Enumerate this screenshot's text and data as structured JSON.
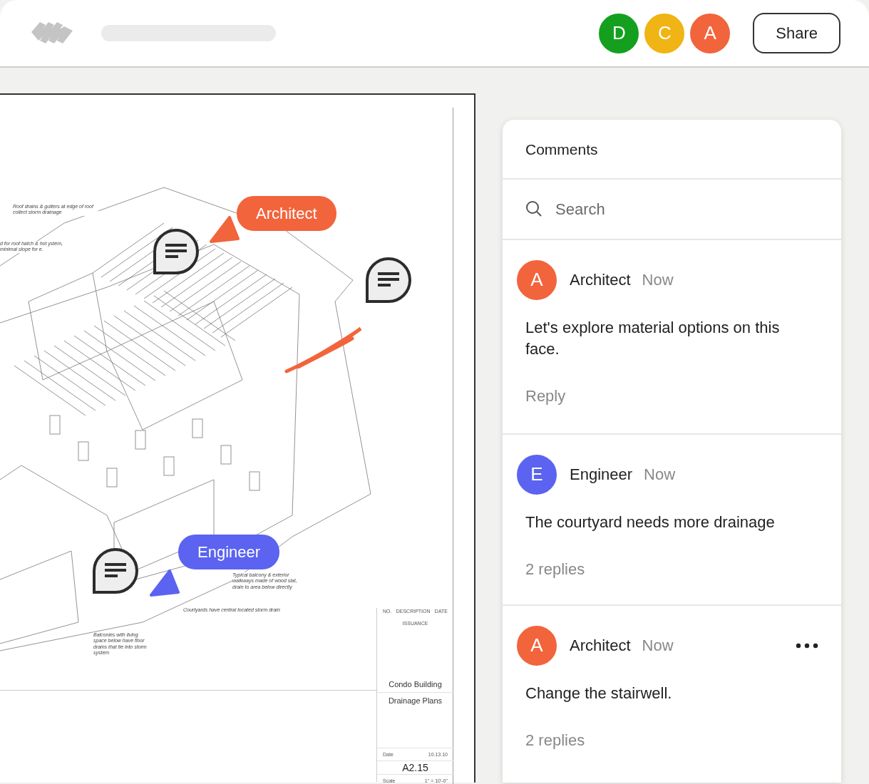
{
  "header": {
    "avatars": [
      {
        "initial": "D",
        "color": "#14a01e"
      },
      {
        "initial": "C",
        "color": "#f0b414"
      },
      {
        "initial": "A",
        "color": "#f2643c"
      }
    ],
    "share_button": "Share"
  },
  "document": {
    "notes": [
      {
        "text": "Roof drains & gutters at edge of roof collect storm drainage"
      },
      {
        "text": "d for roof hatch & hot ystem, minimal slope for e."
      },
      {
        "text": "Typical balcony &  exterior walkways made of wood slat, drain to area below directly"
      },
      {
        "text": "Courtyards have central located storm drain"
      },
      {
        "text": "Balconies with living space below have floor drains that tie into storm system"
      }
    ],
    "cursors": [
      {
        "name": "Architect",
        "color": "#f2643c"
      },
      {
        "name": "Engineer",
        "color": "#5b63f0"
      }
    ],
    "title_block": {
      "columns": [
        "NO.",
        "DESCRIPTION",
        "DATE"
      ],
      "issuance": "ISSUANCE",
      "project": "Condo Building",
      "sheet_title": "Drainage Plans",
      "date_label": "Date",
      "date": "10.13.10",
      "sheet_number": "A2.15",
      "scale_label": "Scale",
      "scale": "1\" = 10'-0\""
    }
  },
  "comments_panel": {
    "title": "Comments",
    "search": {
      "placeholder": "Search"
    },
    "comments": [
      {
        "initial": "A",
        "color": "#f2643c",
        "author": "Architect",
        "time": "Now",
        "text": "Let's explore material options on this face.",
        "footer": "Reply",
        "menu": false
      },
      {
        "initial": "E",
        "color": "#5b63f0",
        "author": "Engineer",
        "time": "Now",
        "text": "The courtyard needs more drainage",
        "footer": "2 replies",
        "menu": false
      },
      {
        "initial": "A",
        "color": "#f2643c",
        "author": "Architect",
        "time": "Now",
        "text": "Change the stairwell.",
        "footer": "2 replies",
        "menu": true
      }
    ]
  }
}
